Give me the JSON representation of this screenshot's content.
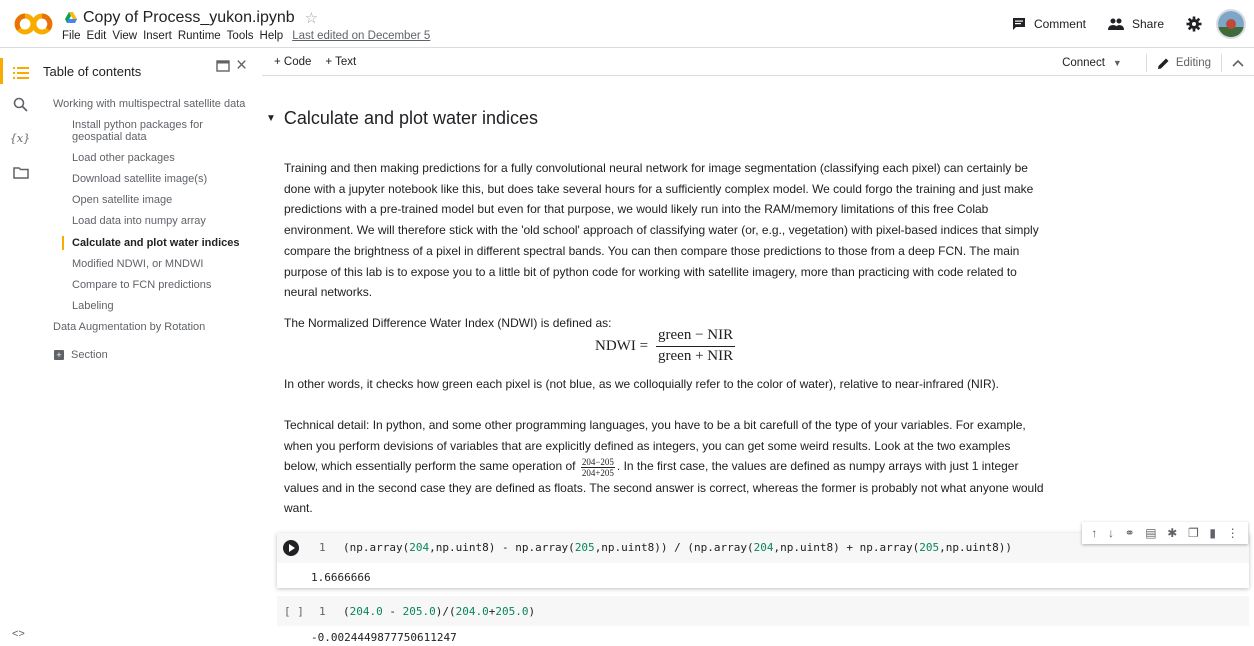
{
  "header": {
    "logo_text": "CO",
    "notebook_title": "Copy of Process_yukon.ipynb",
    "menu": [
      "File",
      "Edit",
      "View",
      "Insert",
      "Runtime",
      "Tools",
      "Help"
    ],
    "last_edited": "Last edited on December 5",
    "comment_label": "Comment",
    "share_label": "Share"
  },
  "toc": {
    "title": "Table of contents",
    "items": [
      {
        "label": "Working with multispectral satellite data",
        "level": 1
      },
      {
        "label": "Install python packages for geospatial data",
        "level": 2
      },
      {
        "label": "Load other packages",
        "level": 2
      },
      {
        "label": "Download satellite image(s)",
        "level": 2
      },
      {
        "label": "Open satellite image",
        "level": 2
      },
      {
        "label": "Load data into numpy array",
        "level": 2
      },
      {
        "label": "Calculate and plot water indices",
        "level": 2
      },
      {
        "label": "Modified NDWI, or MNDWI",
        "level": 2
      },
      {
        "label": "Compare to FCN predictions",
        "level": 2
      },
      {
        "label": "Labeling",
        "level": 2
      },
      {
        "label": "Data Augmentation by Rotation",
        "level": 1
      }
    ],
    "section_label": "Section"
  },
  "toolbar": {
    "add_code": "+ Code",
    "add_text": "+ Text",
    "connect": "Connect",
    "editing": "Editing"
  },
  "content": {
    "heading": "Calculate and plot water indices",
    "para1": "Training and then making predictions for a fully convolutional neural network for image segmentation (classifying each pixel) can certainly be done with a jupyter notebook like this, but does take several hours for a sufficiently complex model. We could forgo the training and just make predictions with a pre-trained model but even for that purpose, we would likely run into the RAM/memory limitations of this free Colab environment. We will therefore stick with the 'old school' approach of classifying water (or, e.g., vegetation) with pixel-based indices that simply compare the brightness of a pixel in different spectral bands. You can then compare those predictions to those from a deep FCN. The main purpose of this lab is to expose you to a little bit of python code for working with satellite imagery, more than practicing with code related to neural networks.",
    "para2": "The Normalized Difference Water Index (NDWI) is defined as:",
    "formula_lhs": "NDWI =",
    "formula_num": "green − NIR",
    "formula_den": "green + NIR",
    "para3": "In other words, it checks how green each pixel is (not blue, as we colloquially refer to the color of water), relative to near-infrared (NIR).",
    "para4_a": "Technical detail: In python, and some other programming languages, you have to be a bit carefull of the type of your variables. For example, when you perform devisions of variables that are explicitly defined as integers, you can get some weird results. Look at the two examples below, which essentially perform the same operation of",
    "inline_num": "204−205",
    "inline_den": "204+205",
    "para4_b": ". In the first case, the values are defined as numpy arrays with just 1 integer values and in the second case they are defined as floats. The second answer is correct, whereas the former is probably not what anyone would want."
  },
  "cells": [
    {
      "line_no": "1",
      "output": "1.6666666"
    },
    {
      "bracket": "[ ]",
      "line_no": "1",
      "output": "-0.0024449877750611247"
    }
  ],
  "colors": {
    "accent": "#f9ab00",
    "number": "#098658"
  }
}
